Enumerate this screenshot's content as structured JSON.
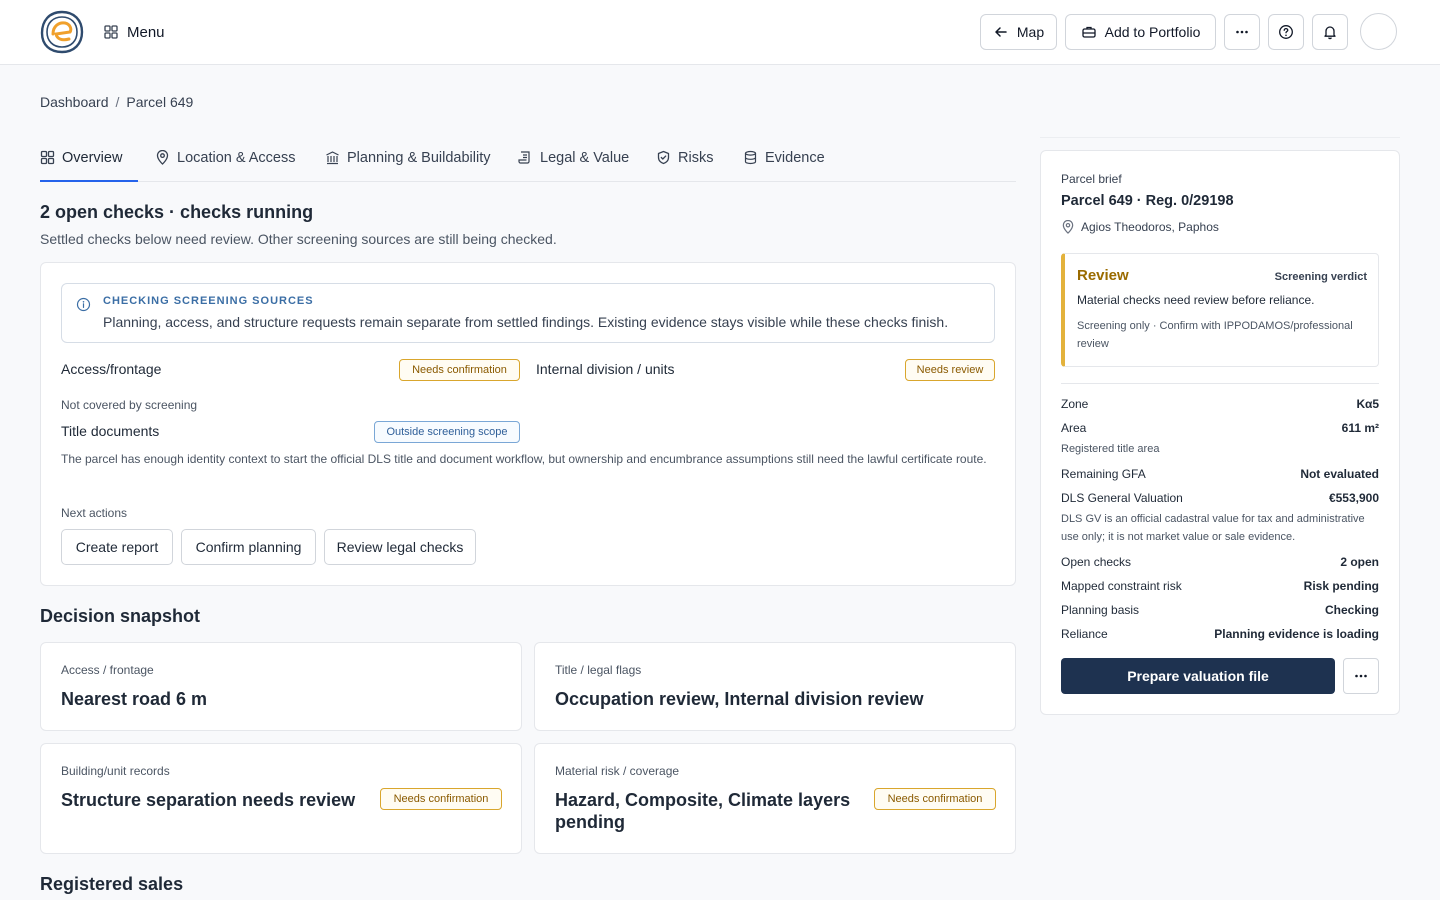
{
  "header": {
    "menu_label": "Menu",
    "map_label": "Map",
    "portfolio_label": "Add to Portfolio"
  },
  "breadcrumb": {
    "root": "Dashboard",
    "separator": "/",
    "current": "Parcel 649"
  },
  "tabs": [
    {
      "label": "Overview",
      "icon": "grid-icon"
    },
    {
      "label": "Location & Access",
      "icon": "map-pin-icon"
    },
    {
      "label": "Planning & Buildability",
      "icon": "building-icon"
    },
    {
      "label": "Legal & Value",
      "icon": "scroll-icon"
    },
    {
      "label": "Risks",
      "icon": "shield-icon"
    },
    {
      "label": "Evidence",
      "icon": "database-icon"
    }
  ],
  "main": {
    "title": "2 open checks · checks running",
    "subtitle": "Settled checks below need review. Other screening sources are still being checked.",
    "notice": {
      "title": "CHECKING SCREENING SOURCES",
      "text": "Planning, access, and structure requests remain separate from settled findings. Existing evidence stays visible while these checks finish."
    },
    "checks": [
      {
        "label": "Access/frontage",
        "badge": "Needs confirmation"
      },
      {
        "label": "Internal division / units",
        "badge": "Needs review"
      }
    ],
    "not_covered_label": "Not covered by screening",
    "title_docs": {
      "label": "Title documents",
      "badge": "Outside screening scope"
    },
    "title_docs_text": "The parcel has enough identity context to start the official DLS title and document workflow, but ownership and encumbrance assumptions still need the lawful certificate route.",
    "next_actions_label": "Next actions",
    "actions": [
      "Create report",
      "Confirm planning",
      "Review legal checks"
    ]
  },
  "snapshot": {
    "title": "Decision snapshot",
    "cards": [
      {
        "label": "Access / frontage",
        "value": "Nearest road 6 m",
        "badge": ""
      },
      {
        "label": "Title / legal flags",
        "value": "Occupation review, Internal division review",
        "badge": ""
      },
      {
        "label": "Building/unit records",
        "value": "Structure separation needs review",
        "badge": "Needs confirmation"
      },
      {
        "label": "Material risk / coverage",
        "value": "Hazard, Composite, Climate layers pending",
        "badge": "Needs confirmation"
      }
    ]
  },
  "sales": {
    "title": "Registered sales"
  },
  "brief": {
    "eyebrow": "Parcel brief",
    "title": "Parcel 649 · Reg. 0/29198",
    "location": "Agios Theodoros, Paphos",
    "verdict": {
      "status": "Review",
      "tag": "Screening verdict",
      "text": "Material checks need review before reliance.",
      "note": "Screening only · Confirm with IPPODAMOS/professional review"
    },
    "zone": {
      "k": "Zone",
      "v": "Κα5"
    },
    "area": {
      "k": "Area",
      "v": "611 m²",
      "note": "Registered title area"
    },
    "gfa": {
      "k": "Remaining GFA",
      "v": "Not evaluated"
    },
    "gv": {
      "k": "DLS General Valuation",
      "v": "€553,900",
      "note": "DLS GV is an official cadastral value for tax and administrative use only; it is not market value or sale evidence."
    },
    "open_checks": {
      "k": "Open checks",
      "v": "2 open"
    },
    "constraint": {
      "k": "Mapped constraint risk",
      "v": "Risk pending"
    },
    "planning": {
      "k": "Planning basis",
      "v": "Checking"
    },
    "reliance": {
      "k": "Reliance",
      "v": "Planning evidence is loading"
    },
    "primary_action": "Prepare valuation file"
  },
  "colors": {
    "accent": "#2563eb",
    "primary": "#1e3250",
    "warning": "#d9a62d",
    "info": "#3b6ea5",
    "verdict": "#9a6b00"
  }
}
